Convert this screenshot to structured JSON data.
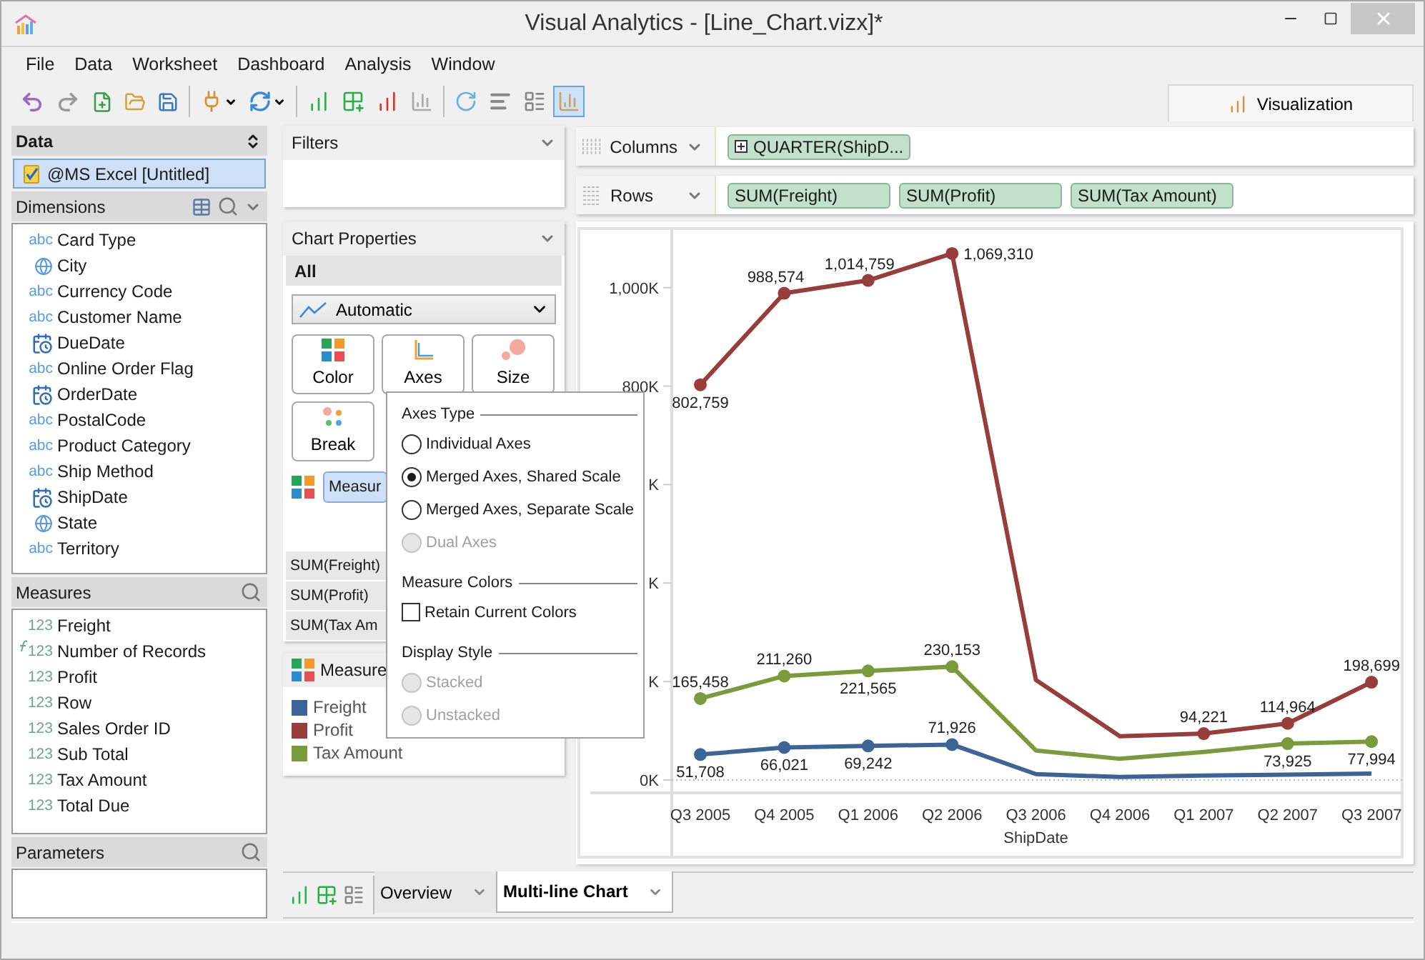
{
  "window": {
    "title": "Visual Analytics - [Line_Chart.vizx]*"
  },
  "menu": [
    "File",
    "Data",
    "Worksheet",
    "Dashboard",
    "Analysis",
    "Window"
  ],
  "ribbon_tab": {
    "label": "Visualization"
  },
  "data_panel": {
    "title": "Data",
    "sources": [
      {
        "label": "@MS Excel [Untitled]",
        "selected": true
      }
    ]
  },
  "dimensions": {
    "title": "Dimensions",
    "items": [
      {
        "kind": "text",
        "badge": "abc",
        "label": "Card Type"
      },
      {
        "kind": "geo",
        "label": "City"
      },
      {
        "kind": "text",
        "badge": "abc",
        "label": "Currency Code"
      },
      {
        "kind": "text",
        "badge": "abc",
        "label": "Customer Name"
      },
      {
        "kind": "date",
        "label": "DueDate"
      },
      {
        "kind": "text",
        "badge": "abc",
        "label": "Online Order Flag"
      },
      {
        "kind": "date",
        "label": "OrderDate"
      },
      {
        "kind": "text",
        "badge": "abc",
        "label": "PostalCode"
      },
      {
        "kind": "text",
        "badge": "abc",
        "label": "Product Category"
      },
      {
        "kind": "text",
        "badge": "abc",
        "label": "Ship Method"
      },
      {
        "kind": "date",
        "label": "ShipDate"
      },
      {
        "kind": "geo",
        "label": "State"
      },
      {
        "kind": "text",
        "badge": "abc",
        "label": "Territory"
      }
    ]
  },
  "measures": {
    "title": "Measures",
    "items": [
      {
        "kind": "number",
        "badge": "123",
        "label": "Freight"
      },
      {
        "kind": "calculated",
        "badge": "123",
        "label": "Number of Records"
      },
      {
        "kind": "number",
        "badge": "123",
        "label": "Profit"
      },
      {
        "kind": "number",
        "badge": "123",
        "label": "Row"
      },
      {
        "kind": "number",
        "badge": "123",
        "label": "Sales Order ID"
      },
      {
        "kind": "number",
        "badge": "123",
        "label": "Sub Total"
      },
      {
        "kind": "number",
        "badge": "123",
        "label": "Tax Amount"
      },
      {
        "kind": "number",
        "badge": "123",
        "label": "Total Due"
      }
    ]
  },
  "parameters": {
    "title": "Parameters"
  },
  "filters": {
    "title": "Filters"
  },
  "chart_properties": {
    "title": "Chart Properties",
    "section": "All",
    "mark_type": "Automatic",
    "buttons": [
      {
        "kind": "color",
        "label": "Color"
      },
      {
        "kind": "axes",
        "label": "Axes"
      },
      {
        "kind": "size",
        "label": "Size"
      },
      {
        "kind": "break",
        "label": "Break"
      }
    ],
    "color_pill": "Measur",
    "measure_rows": [
      "SUM(Freight)",
      "SUM(Profit)",
      "SUM(Tax Am"
    ]
  },
  "legend": {
    "title": "Measure"
  },
  "axes_popup": {
    "groups": [
      {
        "title": "Axes Type",
        "options": [
          {
            "kind": "radio",
            "label": "Individual Axes",
            "selected": false,
            "disabled": false
          },
          {
            "kind": "radio",
            "label": "Merged Axes, Shared Scale",
            "selected": true,
            "disabled": false
          },
          {
            "kind": "radio",
            "label": "Merged Axes, Separate Scale",
            "selected": false,
            "disabled": false
          },
          {
            "kind": "radio",
            "label": "Dual Axes",
            "selected": false,
            "disabled": true
          }
        ]
      },
      {
        "title": "Measure Colors",
        "options": [
          {
            "kind": "checkbox",
            "label": "Retain Current Colors",
            "checked": false
          }
        ]
      },
      {
        "title": "Display Style",
        "options": [
          {
            "kind": "radio",
            "label": "Stacked",
            "selected": false,
            "disabled": true
          },
          {
            "kind": "radio",
            "label": "Unstacked",
            "selected": false,
            "disabled": true
          }
        ]
      }
    ]
  },
  "shelves": [
    {
      "label": "Columns",
      "kind": "columns",
      "pills": [
        {
          "label": "QUARTER(ShipD...",
          "expandable": true
        }
      ]
    },
    {
      "label": "Rows",
      "kind": "rows",
      "pills": [
        {
          "label": "SUM(Freight)",
          "expandable": false
        },
        {
          "label": "SUM(Profit)",
          "expandable": false
        },
        {
          "label": "SUM(Tax Amount)",
          "expandable": false
        }
      ]
    }
  ],
  "chart": {
    "chart_data": {
      "type": "line",
      "xlabel": "ShipDate",
      "categories": [
        "Q3 2005",
        "Q4 2005",
        "Q1 2006",
        "Q2 2006",
        "Q3 2006",
        "Q4 2006",
        "Q1 2007",
        "Q2 2007",
        "Q3 2007"
      ],
      "ylim": [
        0,
        1120000
      ],
      "yticks": [
        {
          "value": 0,
          "label": "0K"
        },
        {
          "value": 200000,
          "label": "K"
        },
        {
          "value": 400000,
          "label": "K"
        },
        {
          "value": 600000,
          "label": "K"
        },
        {
          "value": 800000,
          "label": "800K"
        },
        {
          "value": 1000000,
          "label": "1,000K"
        }
      ],
      "series": [
        {
          "name": "Freight",
          "color": "#3c6496",
          "values": [
            51708,
            66021,
            69242,
            71926,
            12000,
            6000,
            9000,
            11000,
            13000
          ],
          "value_labels": [
            "51,708",
            "66,021",
            "69,242",
            "71,926",
            null,
            null,
            null,
            null,
            null
          ]
        },
        {
          "name": "Profit",
          "color": "#983c3c",
          "values": [
            802759,
            988574,
            1014759,
            1069310,
            203000,
            89000,
            94221,
            114964,
            198699
          ],
          "value_labels": [
            "802,759",
            "988,574",
            "1,014,759",
            "1,069,310",
            null,
            null,
            "94,221",
            "114,964",
            "198,699"
          ]
        },
        {
          "name": "Tax Amount",
          "color": "#7b9a3c",
          "values": [
            165458,
            211260,
            221565,
            230153,
            60000,
            43000,
            57000,
            73925,
            77994
          ],
          "value_labels": [
            "165,458",
            "211,260",
            "221,565",
            "230,153",
            null,
            null,
            null,
            "73,925",
            "77,994"
          ]
        }
      ]
    }
  },
  "sheet_tabs": [
    {
      "label": "Overview",
      "selected": false
    },
    {
      "label": "Multi-line Chart",
      "selected": true
    }
  ]
}
